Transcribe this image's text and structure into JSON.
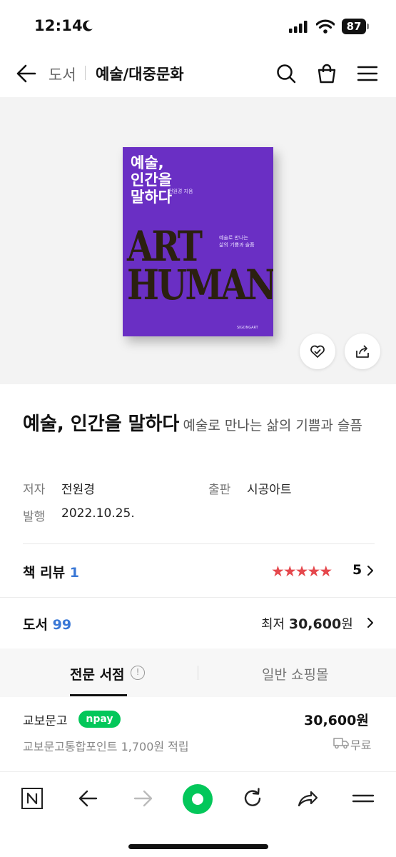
{
  "status": {
    "time": "12:14",
    "battery": "87"
  },
  "header": {
    "crumb_parent": "도서",
    "crumb_current": "예술/대중문화"
  },
  "book_cover": {
    "title": "예술,\n인간을\n말하다",
    "author": "전원경 지음",
    "subtitle": "예술로 만나는\n삶의 기쁨과 슬픔",
    "art_text": "ART\nHUMAN",
    "publisher": "SIGONGART",
    "color": "#6a2fc4"
  },
  "product": {
    "title": "예술, 인간을 말하다",
    "subtitle": "예술로 만나는 삶의 기쁨과 슬픔",
    "author_label": "저자",
    "author": "전원경",
    "publisher_label": "출판",
    "publisher": "시공아트",
    "date_label": "발행",
    "date": "2022.10.25."
  },
  "review": {
    "label": "책 리뷰",
    "count": "1",
    "stars": 5,
    "rating": "5"
  },
  "offers": {
    "label": "도서",
    "count": "99",
    "lowest_label": "최저",
    "lowest_price": "30,600",
    "currency": "원"
  },
  "tabs": {
    "active": "전문 서점",
    "info": "!",
    "inactive": "일반 쇼핑몰"
  },
  "seller": {
    "name": "교보문고",
    "badge": "npay",
    "price": "30,600원",
    "points": "교보문고통합포인트 1,700원 적립",
    "shipping": "무료"
  },
  "colors": {
    "accent_blue": "#3a78d6",
    "star_red": "#e5484d",
    "naver_green": "#03c75a"
  }
}
